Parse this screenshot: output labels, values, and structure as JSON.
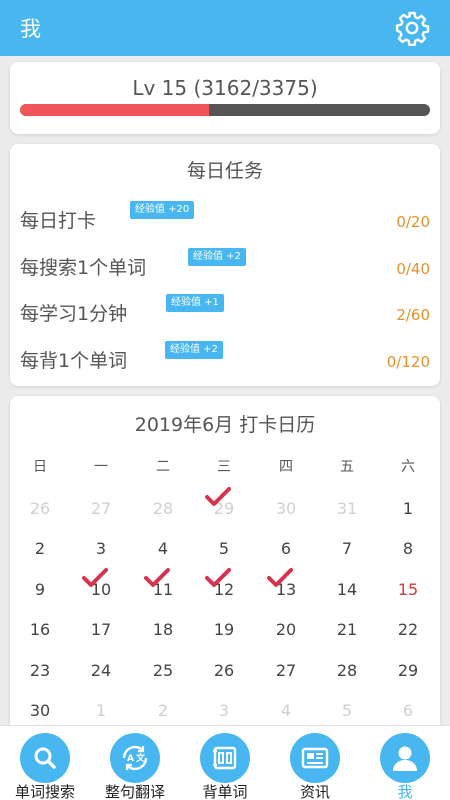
{
  "header": {
    "title": "我"
  },
  "level": {
    "text": "Lv 15  (3162/3375)",
    "progress_fraction": 0.46
  },
  "tasks": {
    "title": "每日任务",
    "items": [
      {
        "name": "每日打卡",
        "badge": "经验值 +20",
        "count": "0/20"
      },
      {
        "name": "每搜索1个单词",
        "badge": "经验值 +2",
        "count": "0/40"
      },
      {
        "name": "每学习1分钟",
        "badge": "经验值 +1",
        "count": "2/60"
      },
      {
        "name": "每背1个单词",
        "badge": "经验值 +2",
        "count": "0/120"
      }
    ]
  },
  "calendar": {
    "title": "2019年6月  打卡日历",
    "weekdays": [
      "日",
      "一",
      "二",
      "三",
      "四",
      "五",
      "六"
    ],
    "weeks": [
      [
        {
          "d": "26",
          "other": true
        },
        {
          "d": "27",
          "other": true
        },
        {
          "d": "28",
          "other": true
        },
        {
          "d": "29",
          "other": true,
          "checked": true
        },
        {
          "d": "30",
          "other": true
        },
        {
          "d": "31",
          "other": true
        },
        {
          "d": "1"
        }
      ],
      [
        {
          "d": "2"
        },
        {
          "d": "3"
        },
        {
          "d": "4"
        },
        {
          "d": "5"
        },
        {
          "d": "6"
        },
        {
          "d": "7"
        },
        {
          "d": "8"
        }
      ],
      [
        {
          "d": "9"
        },
        {
          "d": "10",
          "checked": true
        },
        {
          "d": "11",
          "checked": true
        },
        {
          "d": "12",
          "checked": true
        },
        {
          "d": "13",
          "checked": true
        },
        {
          "d": "14"
        },
        {
          "d": "15",
          "today": true
        }
      ],
      [
        {
          "d": "16"
        },
        {
          "d": "17"
        },
        {
          "d": "18"
        },
        {
          "d": "19"
        },
        {
          "d": "20"
        },
        {
          "d": "21"
        },
        {
          "d": "22"
        }
      ],
      [
        {
          "d": "23"
        },
        {
          "d": "24"
        },
        {
          "d": "25"
        },
        {
          "d": "26"
        },
        {
          "d": "27"
        },
        {
          "d": "28"
        },
        {
          "d": "29"
        }
      ],
      [
        {
          "d": "30"
        },
        {
          "d": "1",
          "other": true
        },
        {
          "d": "2",
          "other": true
        },
        {
          "d": "3",
          "other": true
        },
        {
          "d": "4",
          "other": true
        },
        {
          "d": "5",
          "other": true
        },
        {
          "d": "6",
          "other": true
        }
      ]
    ]
  },
  "tabs": [
    {
      "id": "word-search",
      "label": "单词搜索",
      "icon": "search-icon"
    },
    {
      "id": "sentence-translate",
      "label": "整句翻译",
      "icon": "translate-icon"
    },
    {
      "id": "memorize",
      "label": "背单词",
      "icon": "book-icon"
    },
    {
      "id": "news",
      "label": "资讯",
      "icon": "news-icon"
    },
    {
      "id": "me",
      "label": "我",
      "icon": "person-icon",
      "active": true
    }
  ],
  "colors": {
    "brand": "#48b7f1",
    "progress": "#f0555c",
    "count": "#e5912e",
    "today": "#d23a3a",
    "check": "#d9324e"
  }
}
